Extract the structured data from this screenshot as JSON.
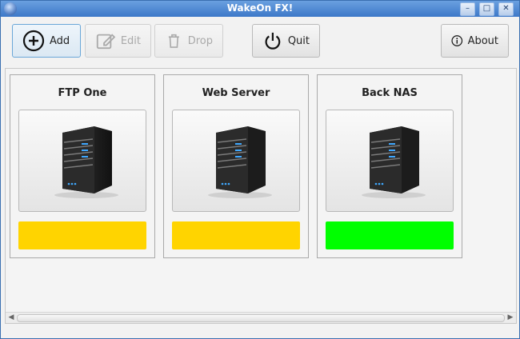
{
  "window": {
    "title": "WakeOn FX!"
  },
  "toolbar": {
    "add_label": "Add",
    "edit_label": "Edit",
    "drop_label": "Drop",
    "quit_label": "Quit",
    "about_label": "About"
  },
  "hosts": [
    {
      "name": "FTP One",
      "status_color": "#FFD400"
    },
    {
      "name": "Web Server",
      "status_color": "#FFD400"
    },
    {
      "name": "Back NAS",
      "status_color": "#00FF00"
    }
  ]
}
